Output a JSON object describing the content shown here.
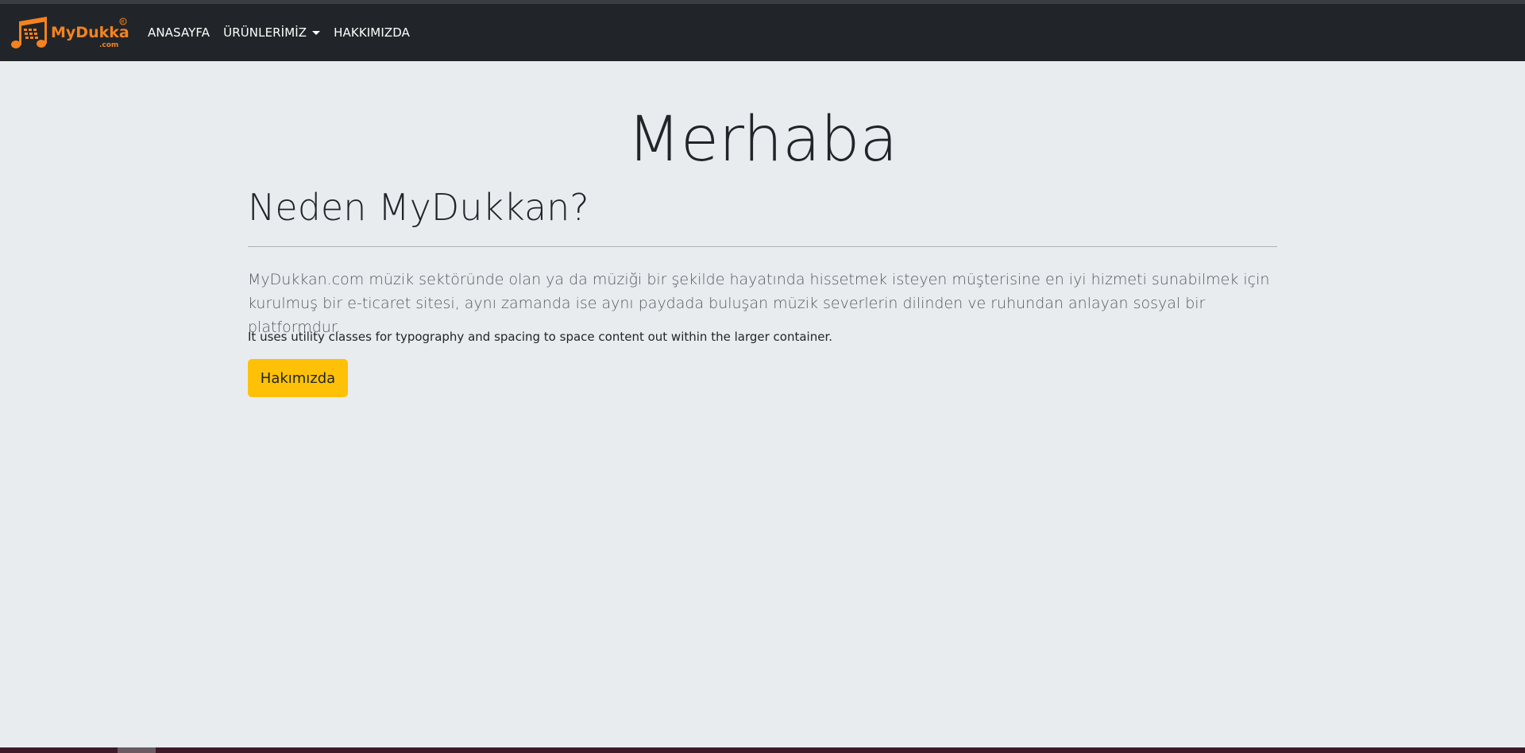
{
  "navbar": {
    "brand": {
      "name": "MyDukkan",
      "suffix": ".com",
      "mark": "®",
      "icon": "music-notes-cart-icon"
    },
    "links": [
      {
        "label": "ANASAYFA"
      },
      {
        "label": "ÜRÜNLERİMİZ",
        "dropdown": true
      },
      {
        "label": "HAKKIMIZDA"
      }
    ]
  },
  "jumbotron": {
    "title": "Merhaba",
    "heading": "Neden MyDukkan?",
    "lead": "MyDukkan.com müzik sektöründe olan ya da müziği bir şekilde hayatında hissetmek isteyen müşterisine en iyi hizmeti sunabilmek için kurulmuş bir e-ticaret sitesi, aynı zamanda ise aynı paydada buluşan müzik severlerin dilinden ve ruhundan anlayan sosyal bir platformdur.",
    "note": "It uses utility classes for typography and spacing to space content out within the larger container.",
    "button_label": "Hakımızda"
  },
  "colors": {
    "navbar_bg": "#212529",
    "page_bg": "#e9ecef",
    "brand_orange": "#f58220",
    "button_bg": "#ffc107"
  }
}
